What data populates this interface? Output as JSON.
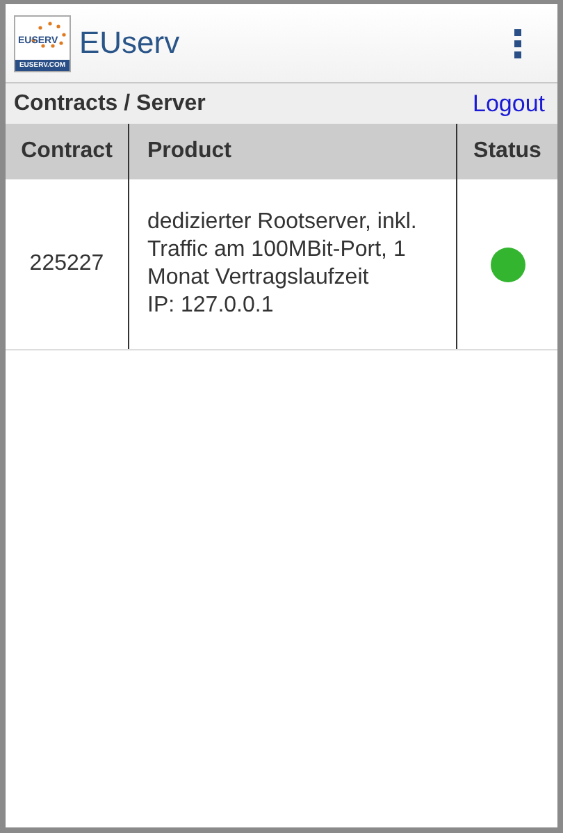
{
  "app_bar": {
    "logo_texts": [
      "EUSERV",
      "EUSERV.COM"
    ],
    "title": "EUserv"
  },
  "subheader": {
    "breadcrumb": "Contracts / Server",
    "logout": "Logout"
  },
  "table": {
    "columns": [
      "Contract",
      "Product",
      "Status"
    ],
    "rows": [
      {
        "contract": "225227",
        "product": "dedizierter Rootserver, inkl. Traffic am 100MBit-Port, 1 Monat Vertragslaufzeit",
        "ip": "IP: 127.0.0.1",
        "color": "#33b52f"
      }
    ]
  }
}
